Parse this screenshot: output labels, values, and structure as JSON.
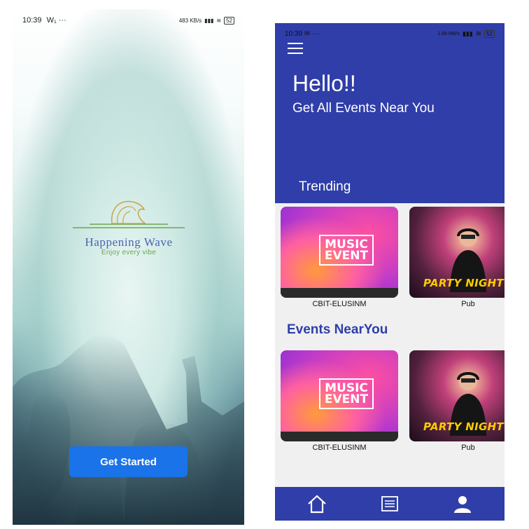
{
  "left": {
    "status": {
      "time": "10:39",
      "extra": "W₁  ···",
      "speed": "483 KB/s",
      "battery": "52"
    },
    "logo": {
      "title": "Happening Wave",
      "tagline": "Enjoy every vibe"
    },
    "cta": {
      "label": "Get Started"
    }
  },
  "right": {
    "status": {
      "time": "10:39",
      "extra": "✉  ···",
      "speed": "1.69 MB/s",
      "battery": "52"
    },
    "header": {
      "greeting": "Hello!!",
      "subtitle": "Get All Events Near You"
    },
    "trending": {
      "title": "Trending",
      "items": [
        {
          "name": "CBIT-ELUSINM",
          "poster_text": "MUSIC EVENT"
        },
        {
          "name": "Pub",
          "poster_text": "PARTY NIGHT"
        }
      ]
    },
    "nearby": {
      "title": "Events NearYou",
      "items": [
        {
          "name": "CBIT-ELUSINM",
          "poster_text": "MUSIC EVENT"
        },
        {
          "name": "Pub",
          "poster_text": "PARTY NIGHT"
        }
      ]
    },
    "nav": {
      "items": [
        "home-icon",
        "list-icon",
        "profile-icon"
      ]
    }
  },
  "colors": {
    "primary": "#2f3ea8",
    "button": "#1a73e8",
    "logo_text": "#4a64b5",
    "tagline": "#6aa84f",
    "poster_yellow": "#ffcc00"
  }
}
